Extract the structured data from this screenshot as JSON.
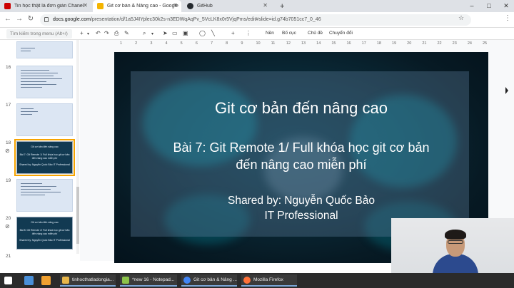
{
  "browser": {
    "tabs": [
      {
        "label": "Tin học thật là đơn giản Chanel",
        "favicon_color": "#cc0000"
      },
      {
        "label": "Git cơ bản & Nâng cao - Google",
        "favicon_color": "#f4b400",
        "active": true
      },
      {
        "label": "GitHub",
        "favicon_color": "#24292e"
      }
    ],
    "new_tab": "+",
    "url_domain": "docs.google.com",
    "url_path": "/presentation/d/1a5J4IYplec30k2s-n3EDWqAqPv_5VcLK8x0r5VjqPms/edit#slide=id.g74b7051cc7_0_46",
    "window_controls": [
      "–",
      "□",
      "✕"
    ]
  },
  "toolbar": {
    "menu_search_placeholder": "Tìm kiếm trong menu (Alt+/)",
    "background_label": "Nền",
    "layout_label": "Bố cục",
    "theme_label": "Chủ đề",
    "transition_label": "Chuyển đổi"
  },
  "ruler_ticks": [
    "1",
    "2",
    "3",
    "4",
    "5",
    "6",
    "7",
    "8",
    "9",
    "10",
    "11",
    "12",
    "13",
    "14",
    "15",
    "16",
    "17",
    "18",
    "19",
    "20",
    "21",
    "22",
    "23",
    "24",
    "25"
  ],
  "slides_panel": [
    {
      "number": "16"
    },
    {
      "number": "17"
    },
    {
      "number": "18",
      "selected": true
    },
    {
      "number": "19"
    },
    {
      "number": "20"
    },
    {
      "number": "21"
    }
  ],
  "slide": {
    "title": "Git cơ bản đến nâng cao",
    "lesson_line1": "Bài 7: Git Remote 1/ Full khóa học git cơ bản",
    "lesson_line2": "đến nâng cao miễn phí",
    "shared_by": "Shared by: Nguyễn Quốc Bảo",
    "role": "IT Professional"
  },
  "thumb_text": {
    "t18_title": "Git cơ bản đến nâng cao",
    "t18_sub": "Bài 7: Git Remote 1/ Full khóa học git cơ bản đến nâng cao miễn phí",
    "t18_by": "Shared by: Nguyễn Quốc Bảo IT Professional",
    "t20_title": "Git cơ bản đến nâng cao",
    "t20_sub": "Bài 8: Git Remote 2/ Full khóa học git cơ bản đến nâng cao miễn phí",
    "t20_by": "Shared by: Nguyễn Quốc Bảo IT Professional"
  },
  "taskbar": {
    "apps": [
      {
        "label": "tinhocthatladongia...",
        "color": "#e8b64a"
      },
      {
        "label": "*new 16 - Notepad...",
        "color": "#8bc34a"
      },
      {
        "label": "Git cơ bản & Nâng ...",
        "color": "#4285f4"
      },
      {
        "label": "Mozilla Firefox",
        "color": "#ff7139"
      }
    ]
  }
}
